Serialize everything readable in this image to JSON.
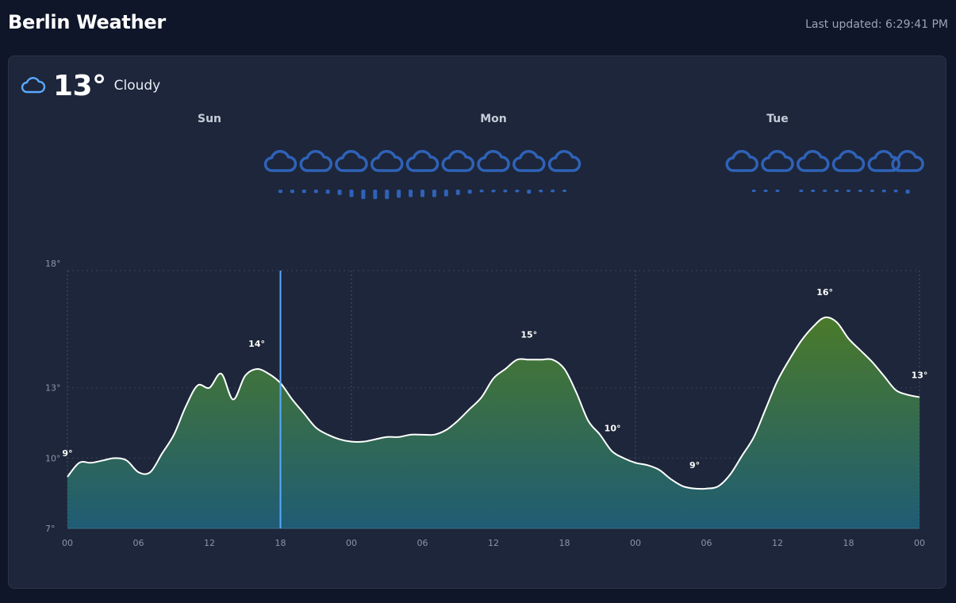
{
  "header": {
    "title": "Berlin Weather",
    "last_updated": "Last updated: 6:29:41 PM"
  },
  "current": {
    "temperature": "13°",
    "condition": "Cloudy",
    "icon": "cloud-icon"
  },
  "days": [
    "Sun",
    "Mon",
    "Tue"
  ],
  "colors": {
    "background": "#0f1629",
    "card": "#1d263a",
    "accent": "#5aa8ff",
    "weather_icons": "#2f62b8",
    "area_top": "#4a7a2a",
    "area_bottom": "#1f5c74",
    "line": "#ffffff"
  },
  "chart_data": {
    "type": "area",
    "ylabel": "",
    "y_ticks": [
      "7°",
      "10°",
      "13°",
      "18°"
    ],
    "x_ticks": [
      "00",
      "06",
      "12",
      "18",
      "00",
      "06",
      "12",
      "18",
      "00",
      "06",
      "12",
      "18",
      "00"
    ],
    "x_unit": "hours",
    "xlim": [
      0,
      72
    ],
    "ylim": [
      7,
      18
    ],
    "current_hour": 18,
    "series": [
      {
        "values": [
          [
            0,
            9.2
          ],
          [
            1,
            9.8
          ],
          [
            2,
            9.8
          ],
          [
            3,
            9.9
          ],
          [
            4,
            10.0
          ],
          [
            5,
            9.9
          ],
          [
            6,
            9.4
          ],
          [
            7,
            9.4
          ],
          [
            8,
            10.2
          ],
          [
            9,
            11.0
          ],
          [
            10,
            12.2
          ],
          [
            11,
            13.1
          ],
          [
            12,
            13.0
          ],
          [
            13,
            13.6
          ],
          [
            14,
            12.5
          ],
          [
            15,
            13.5
          ],
          [
            16,
            13.8
          ],
          [
            17,
            13.6
          ],
          [
            18,
            13.2
          ],
          [
            19,
            12.5
          ],
          [
            20,
            11.9
          ],
          [
            21,
            11.3
          ],
          [
            22,
            11.0
          ],
          [
            23,
            10.8
          ],
          [
            24,
            10.7
          ],
          [
            25,
            10.7
          ],
          [
            26,
            10.8
          ],
          [
            27,
            10.9
          ],
          [
            28,
            10.9
          ],
          [
            29,
            11.0
          ],
          [
            30,
            11.0
          ],
          [
            31,
            11.0
          ],
          [
            32,
            11.2
          ],
          [
            33,
            11.6
          ],
          [
            34,
            12.1
          ],
          [
            35,
            12.6
          ],
          [
            36,
            13.4
          ],
          [
            37,
            13.8
          ],
          [
            38,
            14.2
          ],
          [
            39,
            14.2
          ],
          [
            40,
            14.2
          ],
          [
            41,
            14.2
          ],
          [
            42,
            13.8
          ],
          [
            43,
            12.8
          ],
          [
            44,
            11.6
          ],
          [
            45,
            11.0
          ],
          [
            46,
            10.3
          ],
          [
            47,
            10.0
          ],
          [
            48,
            9.8
          ],
          [
            49,
            9.7
          ],
          [
            50,
            9.5
          ],
          [
            51,
            9.1
          ],
          [
            52,
            8.8
          ],
          [
            53,
            8.7
          ],
          [
            54,
            8.7
          ],
          [
            55,
            8.8
          ],
          [
            56,
            9.3
          ],
          [
            57,
            10.1
          ],
          [
            58,
            10.9
          ],
          [
            59,
            12.1
          ],
          [
            60,
            13.3
          ],
          [
            61,
            14.2
          ],
          [
            62,
            15.0
          ],
          [
            63,
            15.6
          ],
          [
            64,
            16.0
          ],
          [
            65,
            15.8
          ],
          [
            66,
            15.1
          ],
          [
            67,
            14.6
          ],
          [
            68,
            14.1
          ],
          [
            69,
            13.5
          ],
          [
            70,
            12.9
          ],
          [
            71,
            12.7
          ],
          [
            72,
            12.6
          ]
        ]
      }
    ],
    "labels": [
      {
        "x": 0,
        "y": 9.2,
        "text": "9°"
      },
      {
        "x": 17,
        "y": 13.8,
        "text": "14°"
      },
      {
        "x": 39,
        "y": 14.2,
        "text": "15°"
      },
      {
        "x": 47,
        "y": 10.0,
        "text": "10°"
      },
      {
        "x": 53,
        "y": 8.7,
        "text": "9°"
      },
      {
        "x": 64,
        "y": 16.0,
        "text": "16°"
      },
      {
        "x": 72,
        "y": 12.6,
        "text": "13°"
      }
    ],
    "cloud_icon_hours": [
      18,
      21,
      24,
      27,
      30,
      33,
      36,
      39,
      42,
      57,
      60,
      63,
      66,
      69,
      71
    ],
    "precipitation": [
      [
        18,
        0.25
      ],
      [
        19,
        0.25
      ],
      [
        20,
        0.25
      ],
      [
        21,
        0.25
      ],
      [
        22,
        0.3
      ],
      [
        23,
        0.4
      ],
      [
        24,
        0.55
      ],
      [
        25,
        0.7
      ],
      [
        26,
        0.7
      ],
      [
        27,
        0.7
      ],
      [
        28,
        0.6
      ],
      [
        29,
        0.55
      ],
      [
        30,
        0.55
      ],
      [
        31,
        0.55
      ],
      [
        32,
        0.5
      ],
      [
        33,
        0.4
      ],
      [
        34,
        0.3
      ],
      [
        35,
        0.2
      ],
      [
        36,
        0.2
      ],
      [
        37,
        0.2
      ],
      [
        38,
        0.2
      ],
      [
        39,
        0.3
      ],
      [
        40,
        0.2
      ],
      [
        41,
        0.2
      ],
      [
        42,
        0.15
      ],
      [
        58,
        0.08
      ],
      [
        59,
        0.1
      ],
      [
        60,
        0.08
      ],
      [
        62,
        0.1
      ],
      [
        63,
        0.12
      ],
      [
        64,
        0.12
      ],
      [
        65,
        0.12
      ],
      [
        66,
        0.15
      ],
      [
        67,
        0.15
      ],
      [
        68,
        0.15
      ],
      [
        69,
        0.2
      ],
      [
        70,
        0.2
      ],
      [
        71,
        0.3
      ]
    ]
  }
}
